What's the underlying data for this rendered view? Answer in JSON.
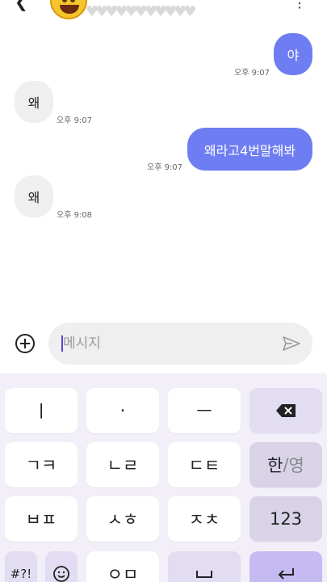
{
  "header": {
    "back_icon": "chevron-left-icon",
    "hearts": "♥♥♥♥♥♥♥♥♥♥♥",
    "more_icon": "more-vertical-icon"
  },
  "messages": [
    {
      "side": "sent",
      "text": "야",
      "time": "오후 9:07"
    },
    {
      "side": "recv",
      "text": "왜",
      "time": "오후 9:07"
    },
    {
      "side": "sent",
      "text": "왜라고4번말해봐",
      "time": "오후 9:07"
    },
    {
      "side": "recv",
      "text": "왜",
      "time": "오후 9:08"
    }
  ],
  "composer": {
    "placeholder": "메시지",
    "value": ""
  },
  "keyboard": {
    "row1": [
      "ㅣ",
      "·",
      "ㅡ"
    ],
    "row2": [
      "ㄱㅋ",
      "ㄴㄹ",
      "ㄷㅌ"
    ],
    "lang_main": "한",
    "lang_sep": "/",
    "lang_alt": "영",
    "row3": [
      "ㅂㅍ",
      "ㅅㅎ",
      "ㅈㅊ"
    ],
    "numbers_key": "123",
    "row4": [
      "#?!",
      "ㅇㅁ"
    ]
  },
  "colors": {
    "sent_bubble": "#6f7df2",
    "recv_bubble": "#efefef",
    "keyboard_bg": "#f2eff8",
    "accent_key": "#c6baf2"
  }
}
